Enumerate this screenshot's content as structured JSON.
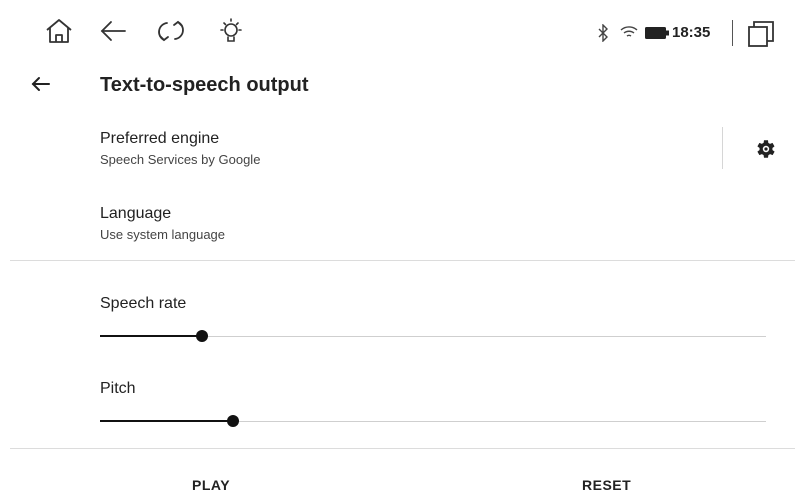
{
  "statusbar": {
    "icons": [
      "home-icon",
      "back-arrow-icon",
      "refresh-icon",
      "brightness-icon"
    ],
    "system_icons": [
      "bluetooth-icon",
      "wifi-icon",
      "battery-icon"
    ],
    "time": "18:35",
    "recents_icon": "recent-apps-icon"
  },
  "header": {
    "title": "Text-to-speech output"
  },
  "engine": {
    "title": "Preferred engine",
    "subtitle": "Speech Services by Google",
    "settings_icon": "gear-icon"
  },
  "language": {
    "title": "Language",
    "subtitle": "Use system language"
  },
  "sliders": {
    "speech_rate": {
      "label": "Speech rate",
      "fraction": 0.153
    },
    "pitch": {
      "label": "Pitch",
      "fraction": 0.2
    }
  },
  "actions": {
    "play": "PLAY",
    "reset": "RESET"
  }
}
